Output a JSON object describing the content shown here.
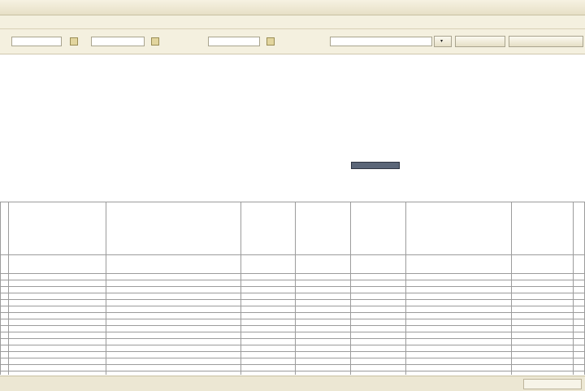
{
  "window": {
    "title": ""
  },
  "menu": {
    "label": ""
  },
  "toolbar": {
    "period_from_label": "",
    "period_from_value": "",
    "period_to_label": "",
    "period_to_value": "",
    "date_label": "",
    "date_value": "",
    "counterparty_label": "",
    "counterparty_value": "",
    "button_generate": "",
    "button_settings": ""
  },
  "document": {
    "appendix_lines": [
      "",
      "",
      "",
      "",
      ""
    ],
    "title": "",
    "subtitle": "",
    "date_line": "",
    "place_line": "",
    "selected_cell": "",
    "intro_lines": [
      "",
      ""
    ]
  },
  "table": {
    "columns": [
      "",
      "",
      "",
      "",
      "",
      "",
      "",
      "",
      ""
    ],
    "group_row": {
      "name": "",
      "subject": ""
    },
    "rows": [
      [
        "",
        "",
        "",
        "",
        "",
        "",
        "",
        "",
        ""
      ],
      [
        "",
        "",
        "",
        "",
        "",
        "",
        "",
        "",
        ""
      ],
      [
        "",
        "",
        "",
        "",
        "",
        "",
        "",
        "",
        ""
      ],
      [
        "",
        "",
        "",
        "",
        "",
        "",
        "",
        "",
        ""
      ],
      [
        "",
        "",
        "",
        "",
        "",
        "",
        "",
        "",
        ""
      ],
      [
        "",
        "",
        "",
        "",
        "",
        "",
        "",
        "",
        ""
      ],
      [
        "",
        "",
        "",
        "",
        "",
        "",
        "",
        "",
        ""
      ],
      [
        "",
        "",
        "",
        "",
        "",
        "",
        "",
        "",
        ""
      ],
      [
        "",
        "",
        "",
        "",
        "",
        "",
        "",
        "",
        ""
      ],
      [
        "",
        "",
        "",
        "",
        "",
        "",
        "",
        "",
        ""
      ],
      [
        "",
        "",
        "",
        "",
        "",
        "",
        "",
        "",
        ""
      ],
      [
        "",
        "",
        "",
        "",
        "",
        "",
        "",
        "",
        ""
      ],
      [
        "",
        "",
        "",
        "",
        "",
        "",
        "",
        "",
        ""
      ],
      [
        "",
        "",
        "",
        "",
        "",
        "",
        "",
        "",
        ""
      ],
      [
        "",
        "",
        "",
        "",
        "",
        "",
        "",
        "",
        ""
      ],
      [
        "",
        "",
        "",
        "",
        "",
        "",
        "",
        "",
        ""
      ],
      [
        "",
        "",
        "",
        "",
        "",
        "",
        "",
        "",
        ""
      ],
      [
        "",
        "",
        "",
        "",
        "",
        "",
        "",
        "",
        ""
      ],
      [
        "",
        "",
        "",
        "",
        "",
        "",
        "",
        "",
        ""
      ]
    ]
  },
  "statusbar": {
    "text": ""
  }
}
